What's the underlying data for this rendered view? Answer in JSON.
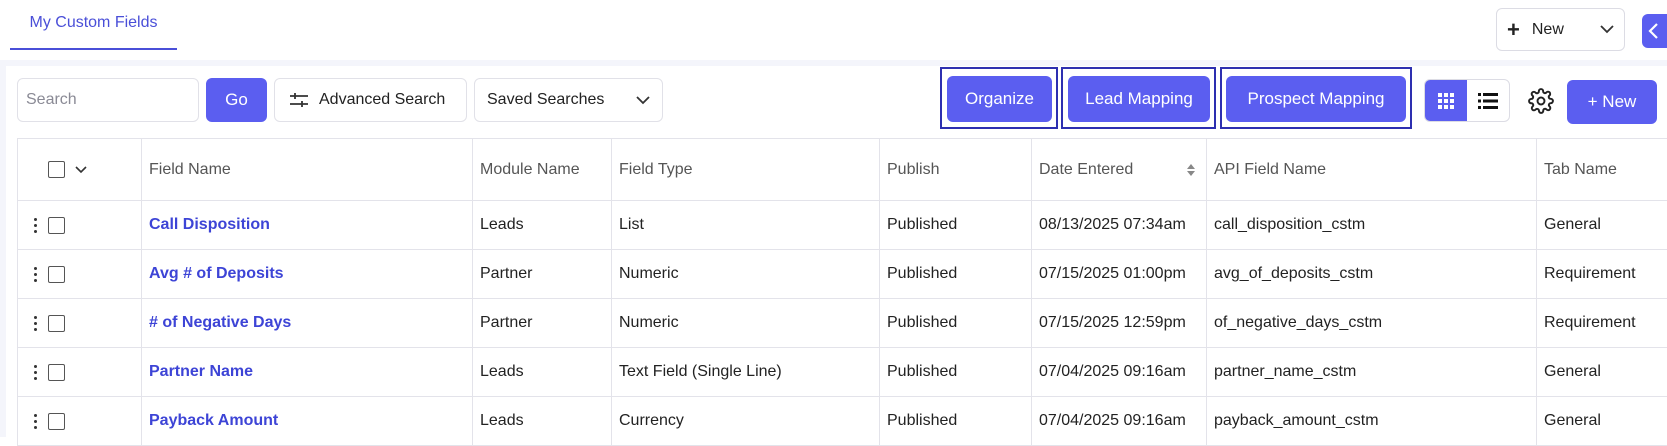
{
  "tabs": {
    "active_label": "My Custom Fields"
  },
  "header": {
    "new_label": "New"
  },
  "toolbar": {
    "search_placeholder": "Search",
    "go_label": "Go",
    "advanced_search_label": "Advanced Search",
    "saved_searches_label": "Saved Searches",
    "organize_label": "Organize",
    "lead_mapping_label": "Lead Mapping",
    "prospect_mapping_label": "Prospect Mapping",
    "new_label": "+ New"
  },
  "table": {
    "columns": [
      "Field Name",
      "Module Name",
      "Field Type",
      "Publish",
      "Date Entered",
      "API Field Name",
      "Tab Name"
    ],
    "rows": [
      [
        "Call Disposition",
        "Leads",
        "List",
        "Published",
        "08/13/2025 07:34am",
        "call_disposition_cstm",
        "General"
      ],
      [
        "Avg # of Deposits",
        "Partner",
        "Numeric",
        "Published",
        "07/15/2025 01:00pm",
        "avg_of_deposits_cstm",
        "Requirement"
      ],
      [
        "# of Negative Days",
        "Partner",
        "Numeric",
        "Published",
        "07/15/2025 12:59pm",
        "of_negative_days_cstm",
        "Requirement"
      ],
      [
        "Partner Name",
        "Leads",
        "Text Field (Single Line)",
        "Published",
        "07/04/2025 09:16am",
        "partner_name_cstm",
        "General"
      ],
      [
        "Payback Amount",
        "Leads",
        "Currency",
        "Published",
        "07/04/2025 09:16am",
        "payback_amount_cstm",
        "General"
      ]
    ]
  },
  "colors": {
    "accent": "#5b5ef0",
    "link": "#3d44d6",
    "highlight_border": "#2d2fb0"
  },
  "icons": [
    "plus-icon",
    "chevron-down-icon",
    "chevron-left-icon",
    "sliders-icon",
    "grid-view-icon",
    "list-view-icon",
    "gear-icon",
    "sort-icon",
    "kebab-menu-icon"
  ]
}
